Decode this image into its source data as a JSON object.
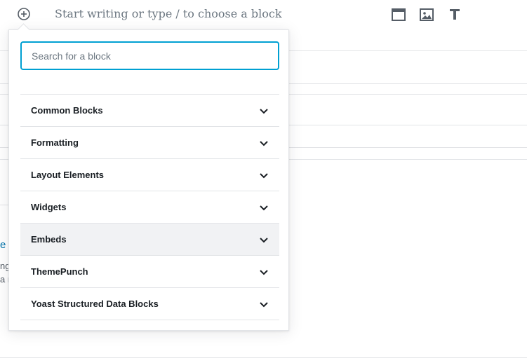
{
  "editor": {
    "placeholder": "Start writing or type / to choose a block",
    "add_block_icon": "plus-circle-icon",
    "toolbar_icons": [
      "cover-block-icon",
      "image-block-icon",
      "heading-block-icon"
    ]
  },
  "background": {
    "link_fragment": "e",
    "text_fragment_1": "ng",
    "text_fragment_2": "a r"
  },
  "inserter": {
    "search_placeholder": "Search for a block",
    "search_value": "",
    "categories": [
      {
        "label": "Common Blocks"
      },
      {
        "label": "Formatting"
      },
      {
        "label": "Layout Elements"
      },
      {
        "label": "Widgets"
      },
      {
        "label": "Embeds"
      },
      {
        "label": "ThemePunch"
      },
      {
        "label": "Yoast Structured Data Blocks"
      }
    ],
    "highlighted": "Embeds",
    "chevron_icon": "chevron-down-icon"
  },
  "colors": {
    "focus_border": "#00a0d2",
    "link": "#0073aa",
    "highlight_bg": "#f1f2f4"
  }
}
